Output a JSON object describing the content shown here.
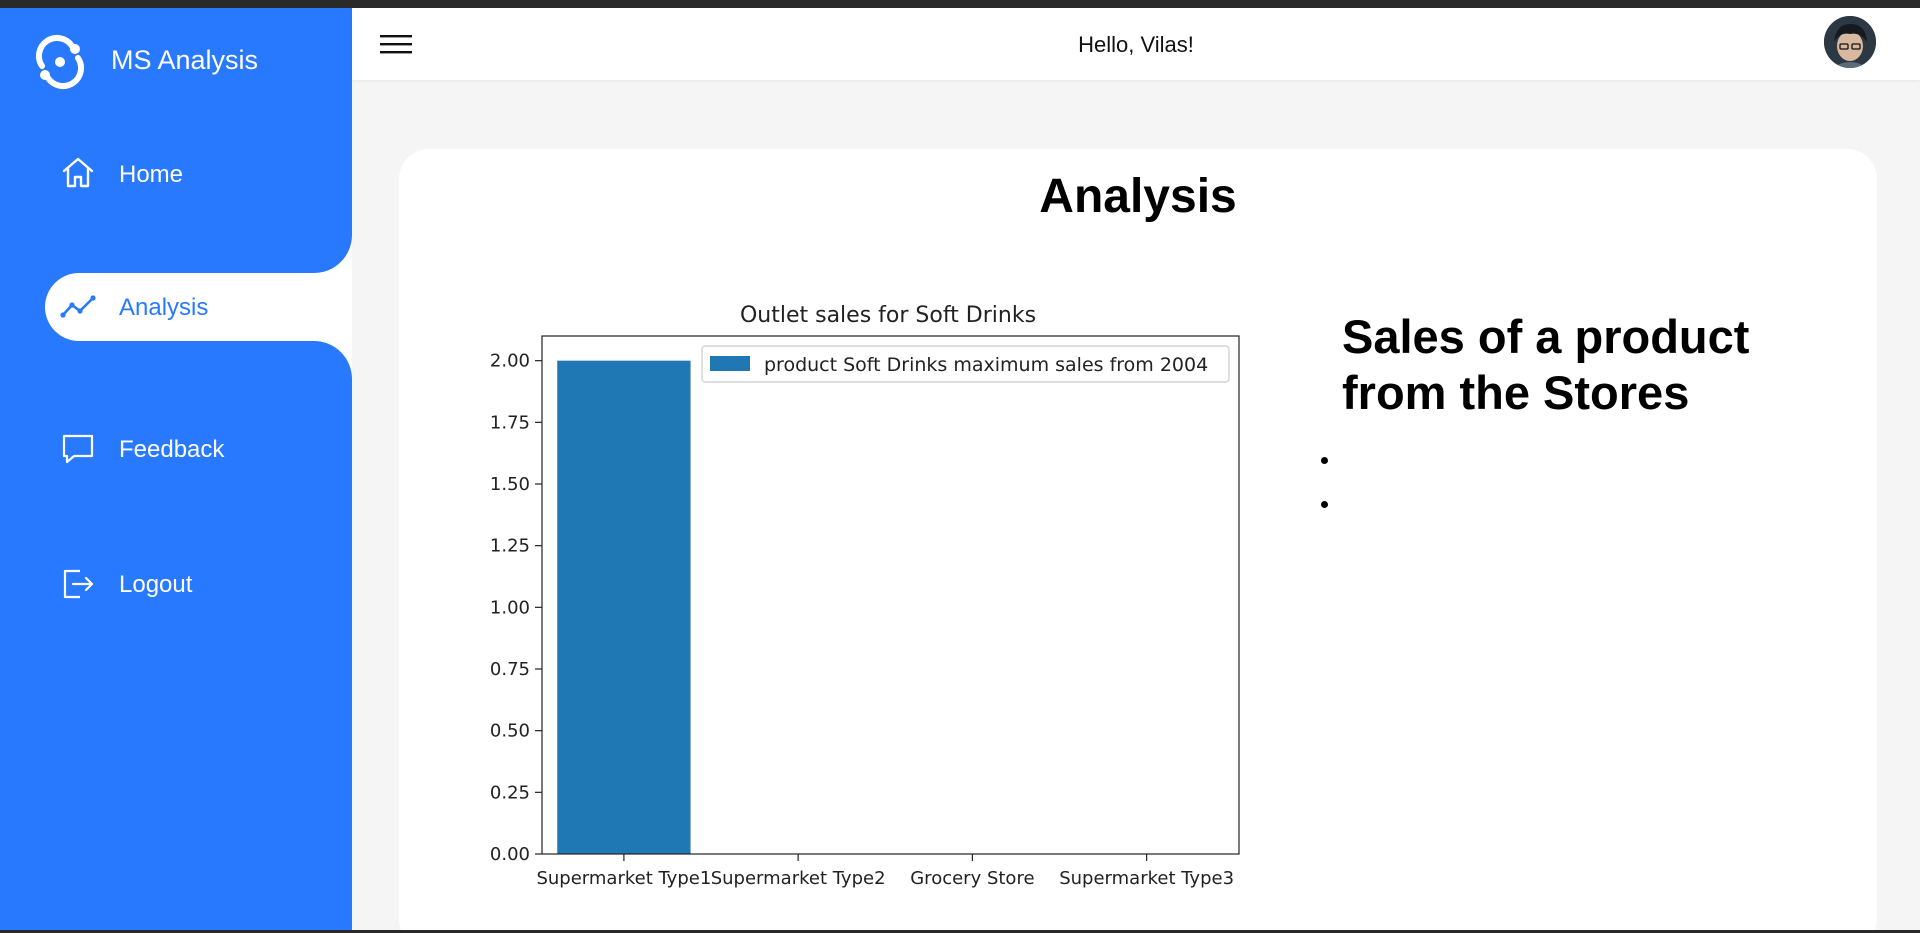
{
  "brand": {
    "name": "MS Analysis",
    "logo_icon": "circular-arrows-logo",
    "accent_color": "#2979ff"
  },
  "sidebar": {
    "items": [
      {
        "label": "Home",
        "icon": "home-icon",
        "active": false
      },
      {
        "label": "Analysis",
        "icon": "trend-line-icon",
        "active": true
      },
      {
        "label": "Feedback",
        "icon": "chat-bubble-icon",
        "active": false
      },
      {
        "label": "Logout",
        "icon": "logout-icon",
        "active": false
      }
    ]
  },
  "header": {
    "menu_icon": "hamburger-menu-icon",
    "greeting": "Hello, Vilas!",
    "avatar_icon": "user-avatar"
  },
  "main": {
    "title": "Analysis",
    "side_heading": "Sales of a product from the Stores",
    "side_list": [
      "",
      ""
    ]
  },
  "chart_data": {
    "type": "bar",
    "title": "Outlet sales for Soft Drinks",
    "categories": [
      "Supermarket Type1",
      "Supermarket Type2",
      "Grocery Store",
      "Supermarket Type3"
    ],
    "series": [
      {
        "name": "product Soft Drinks maximum sales from 2004",
        "values": [
          2,
          0,
          0,
          0
        ],
        "color": "#1f77b4"
      }
    ],
    "ylim": [
      0,
      2.1
    ],
    "yticks": [
      "0.00",
      "0.25",
      "0.50",
      "0.75",
      "1.00",
      "1.25",
      "1.50",
      "1.75",
      "2.00"
    ],
    "ytick_values": [
      0,
      0.25,
      0.5,
      0.75,
      1.0,
      1.25,
      1.5,
      1.75,
      2.0
    ],
    "xlabel": "",
    "ylabel": "",
    "legend_position": "top-right",
    "grid": false
  }
}
